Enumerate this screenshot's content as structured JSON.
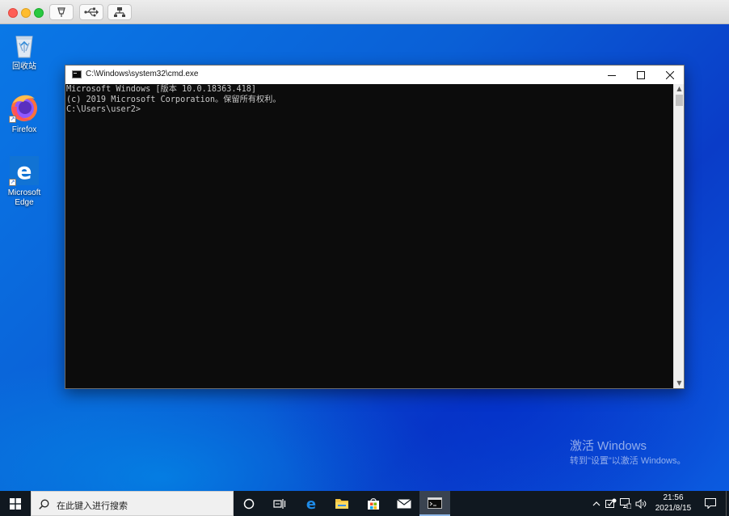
{
  "desktop": {
    "icons": [
      {
        "label": "回收站"
      },
      {
        "label": "Firefox"
      },
      {
        "label": "Microsoft Edge"
      }
    ]
  },
  "cmd_window": {
    "title": "C:\\Windows\\system32\\cmd.exe",
    "console_lines": [
      "Microsoft Windows [版本 10.0.18363.418]",
      "(c) 2019 Microsoft Corporation。保留所有权利。",
      "",
      "C:\\Users\\user2>"
    ]
  },
  "watermark": {
    "line1": "激活 Windows",
    "line2": "转到\"设置\"以激活 Windows。"
  },
  "taskbar": {
    "search_placeholder": "在此键入进行搜索",
    "clock_time": "21:56",
    "clock_date": "2021/8/15"
  },
  "colors": {
    "desktop_blue": "#0a5fd6",
    "console_bg": "#0c0c0c",
    "console_text": "#c7c7c7",
    "taskbar_bg": "#101820"
  },
  "icons": [
    "restore-icon",
    "usb-icon",
    "network-icon",
    "recycle-bin-icon",
    "firefox-icon",
    "edge-icon",
    "cmd-icon",
    "windows-start-icon",
    "search-icon",
    "cortana-icon",
    "task-view-icon",
    "file-explorer-icon",
    "store-icon",
    "mail-icon",
    "chevron-up-icon",
    "security-icon",
    "network-tray-icon",
    "volume-icon",
    "notification-icon"
  ]
}
